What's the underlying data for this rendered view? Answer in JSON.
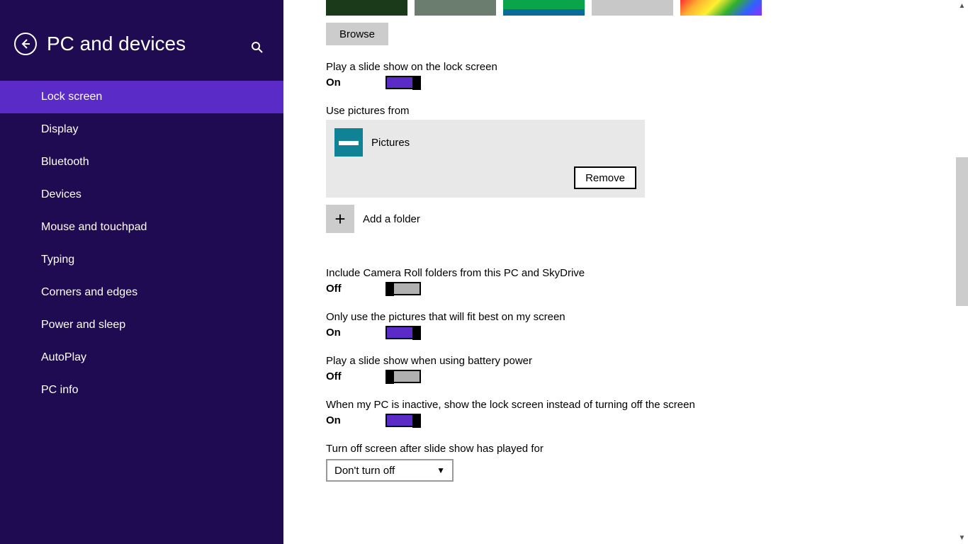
{
  "sidebar": {
    "title": "PC and devices",
    "items": [
      {
        "label": "Lock screen",
        "active": true
      },
      {
        "label": "Display",
        "active": false
      },
      {
        "label": "Bluetooth",
        "active": false
      },
      {
        "label": "Devices",
        "active": false
      },
      {
        "label": "Mouse and touchpad",
        "active": false
      },
      {
        "label": "Typing",
        "active": false
      },
      {
        "label": "Corners and edges",
        "active": false
      },
      {
        "label": "Power and sleep",
        "active": false
      },
      {
        "label": "AutoPlay",
        "active": false
      },
      {
        "label": "PC info",
        "active": false
      }
    ]
  },
  "content": {
    "browse_label": "Browse",
    "slideshow": {
      "label": "Play a slide show on the lock screen",
      "state": "On",
      "on": true
    },
    "use_pictures_label": "Use pictures from",
    "folder": {
      "name": "Pictures",
      "remove_label": "Remove"
    },
    "add_folder_label": "Add a folder",
    "camera_roll": {
      "label": "Include Camera Roll folders from this PC and SkyDrive",
      "state": "Off",
      "on": false
    },
    "fit_best": {
      "label": "Only use the pictures that will fit best on my screen",
      "state": "On",
      "on": true
    },
    "battery": {
      "label": "Play a slide show when using battery power",
      "state": "Off",
      "on": false
    },
    "inactive": {
      "label": "When my PC is inactive, show the lock screen instead of turning off the screen",
      "state": "On",
      "on": true
    },
    "turn_off": {
      "label": "Turn off screen after slide show has played for",
      "value": "Don't turn off"
    }
  }
}
